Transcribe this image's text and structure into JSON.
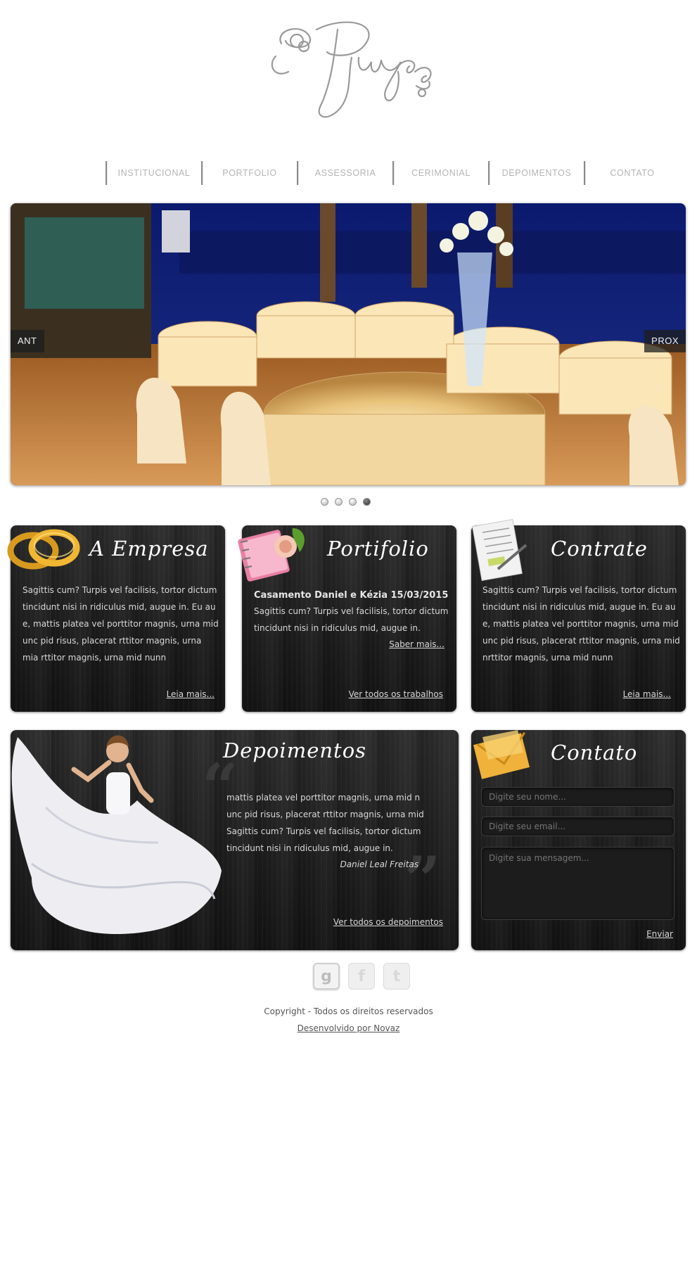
{
  "nav": {
    "items": [
      "INSTITUCIONAL",
      "PORTFOLIO",
      "ASSESSORIA",
      "CERIMONIAL",
      "DEPOIMENTOS",
      "CONTATO"
    ]
  },
  "slider": {
    "prev_label": "ANT",
    "next_label": "PROX",
    "slide_count": 4,
    "active_index": 3
  },
  "empresa": {
    "title": "A Empresa",
    "text": "Sagittis cum? Turpis vel facilisis, tortor dictum tincidunt nisi in ridiculus mid, augue in. Eu au e, mattis platea vel porttitor magnis, urna mid unc pid risus, placerat rttitor magnis, urna mia rttitor magnis, urna mid nunn",
    "link": "Leia mais..."
  },
  "portfolio": {
    "title": "Portifolio",
    "event_title": "Casamento Daniel e Kézia 15/03/2015",
    "text": "Sagittis cum? Turpis vel facilisis, tortor dictum tincidunt nisi in ridiculus mid, augue in.",
    "saber_mais": "Saber mais...",
    "link": "Ver todos os trabalhos"
  },
  "contrate": {
    "title": "Contrate",
    "text": "Sagittis cum? Turpis vel facilisis, tortor dictum tincidunt nisi in ridiculus mid, augue in. Eu au e, mattis platea vel porttitor magnis, urna mid unc pid risus, placerat rttitor magnis, urna mid nrttitor magnis, urna mid nunn",
    "link": "Leia mais..."
  },
  "depoimentos": {
    "title": "Depoimentos",
    "quote": "mattis platea vel porttitor magnis, urna mid n unc pid risus, placerat rttitor magnis, urna mid Sagittis cum? Turpis vel facilisis, tortor dictum tincidunt nisi in ridiculus mid, augue in.",
    "author": "Daniel Leal Freitas",
    "link": "Ver todos os depoimentos"
  },
  "contato": {
    "title": "Contato",
    "name_placeholder": "Digite seu nome...",
    "email_placeholder": "Digite seu email...",
    "message_placeholder": "Digite sua mensagem...",
    "submit_label": "Enviar"
  },
  "footer": {
    "social": [
      "g",
      "f",
      "t"
    ],
    "copyright": "Copyright - Todos os direitos reservados",
    "developed_by": "Desenvolvido por Novaz"
  },
  "colors": {
    "panel_bg": "#1e1e1e",
    "nav_text": "#b4b4b4",
    "panel_text": "#d8d8d8"
  }
}
